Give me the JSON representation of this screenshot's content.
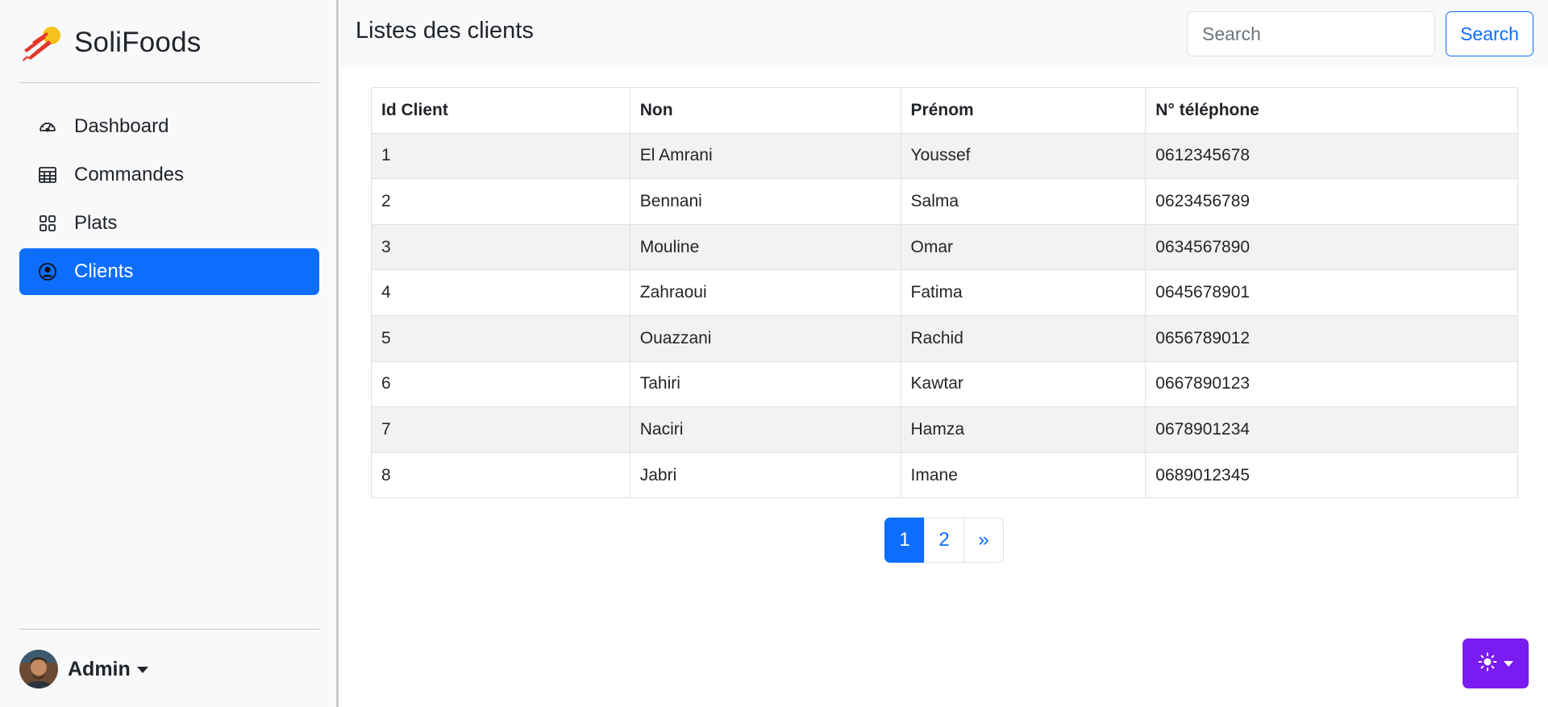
{
  "brand": {
    "name": "SoliFoods"
  },
  "sidebar": {
    "items": [
      {
        "label": "Dashboard",
        "icon": "speedometer-icon"
      },
      {
        "label": "Commandes",
        "icon": "table-icon"
      },
      {
        "label": "Plats",
        "icon": "grid-icon"
      },
      {
        "label": "Clients",
        "icon": "person-circle-icon",
        "active": true
      }
    ],
    "user": {
      "name": "Admin"
    }
  },
  "header": {
    "title": "Listes des clients",
    "search_placeholder": "Search",
    "search_button": "Search"
  },
  "table": {
    "columns": [
      "Id Client",
      "Non",
      "Prénom",
      "N° téléphone"
    ],
    "rows": [
      [
        "1",
        "El Amrani",
        "Youssef",
        "0612345678"
      ],
      [
        "2",
        "Bennani",
        "Salma",
        "0623456789"
      ],
      [
        "3",
        "Mouline",
        "Omar",
        "0634567890"
      ],
      [
        "4",
        "Zahraoui",
        "Fatima",
        "0645678901"
      ],
      [
        "5",
        "Ouazzani",
        "Rachid",
        "0656789012"
      ],
      [
        "6",
        "Tahiri",
        "Kawtar",
        "0667890123"
      ],
      [
        "7",
        "Naciri",
        "Hamza",
        "0678901234"
      ],
      [
        "8",
        "Jabri",
        "Imane",
        "0689012345"
      ]
    ]
  },
  "pagination": {
    "pages": [
      "1",
      "2"
    ],
    "current": "1",
    "next": "»"
  },
  "theme_toggle": {
    "icon": "sun-icon",
    "color": "#7a1bf2"
  },
  "colors": {
    "primary": "#0d6efd",
    "sidebar_bg": "#f8f9fa"
  }
}
